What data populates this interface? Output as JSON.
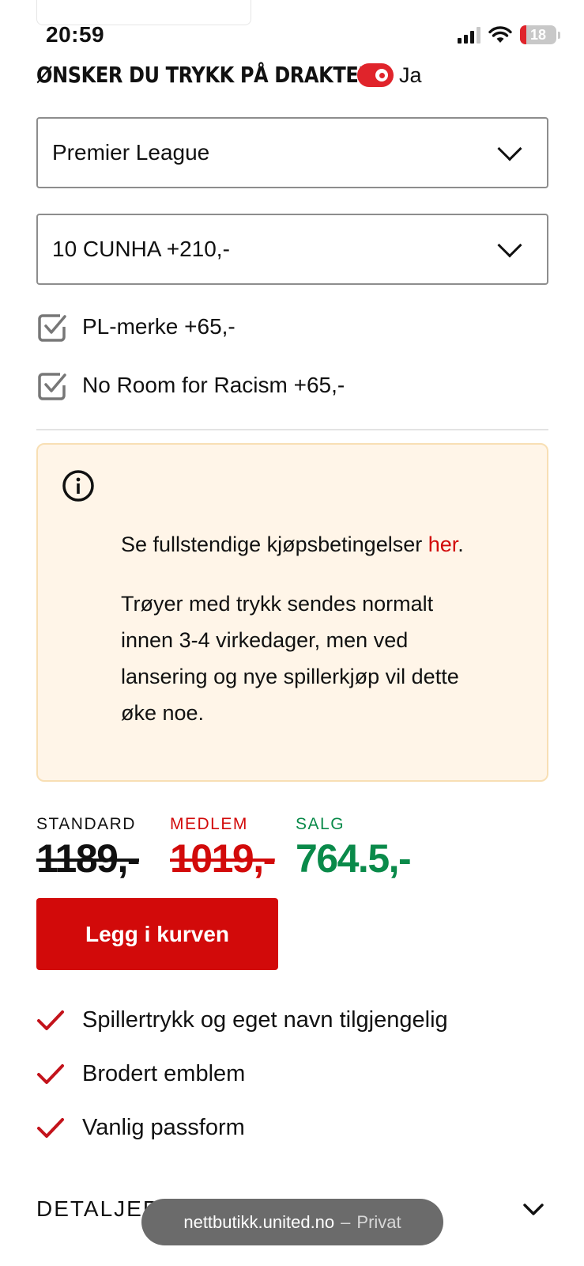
{
  "status_bar": {
    "time": "20:59",
    "battery": "18",
    "accent_low_battery": "#e0242b"
  },
  "print_option": {
    "heading": "ØNSKER DU TRYKK PÅ DRAKTEN?",
    "toggle_label": "Ja",
    "toggle_on": true
  },
  "selects": {
    "league": "Premier League",
    "player": "10 CUNHA +210,-"
  },
  "checkboxes": [
    {
      "label": "PL-merke +65,-",
      "checked": true
    },
    {
      "label": "No Room for Racism +65,-",
      "checked": true
    }
  ],
  "info": {
    "terms_prefix": "Se fullstendige kjøpsbetingelser ",
    "terms_link": "her",
    "terms_suffix": ".",
    "shipping_lines": [
      "Trøyer med trykk sendes normalt",
      "innen 3-4 virkedager, men ved",
      "lansering og nye spillerkjøp vil dette",
      "øke noe."
    ]
  },
  "prices": {
    "standard_label": "STANDARD",
    "standard_value": "1189,-",
    "member_label": "MEDLEM",
    "member_value": "1019,-",
    "sale_label": "SALG",
    "sale_value": "764.5,-",
    "colors": {
      "standard": "#111111",
      "member": "#d20a0a",
      "sale": "#0a8a4a"
    }
  },
  "cart_button": "Legg i kurven",
  "features": [
    "Spillertrykk og eget navn tilgjengelig",
    "Brodert emblem",
    "Vanlig passform"
  ],
  "details_label": "DETALJER",
  "url_bar": {
    "domain": "nettbutikk.united.no",
    "separator": "–",
    "mode": "Privat"
  }
}
